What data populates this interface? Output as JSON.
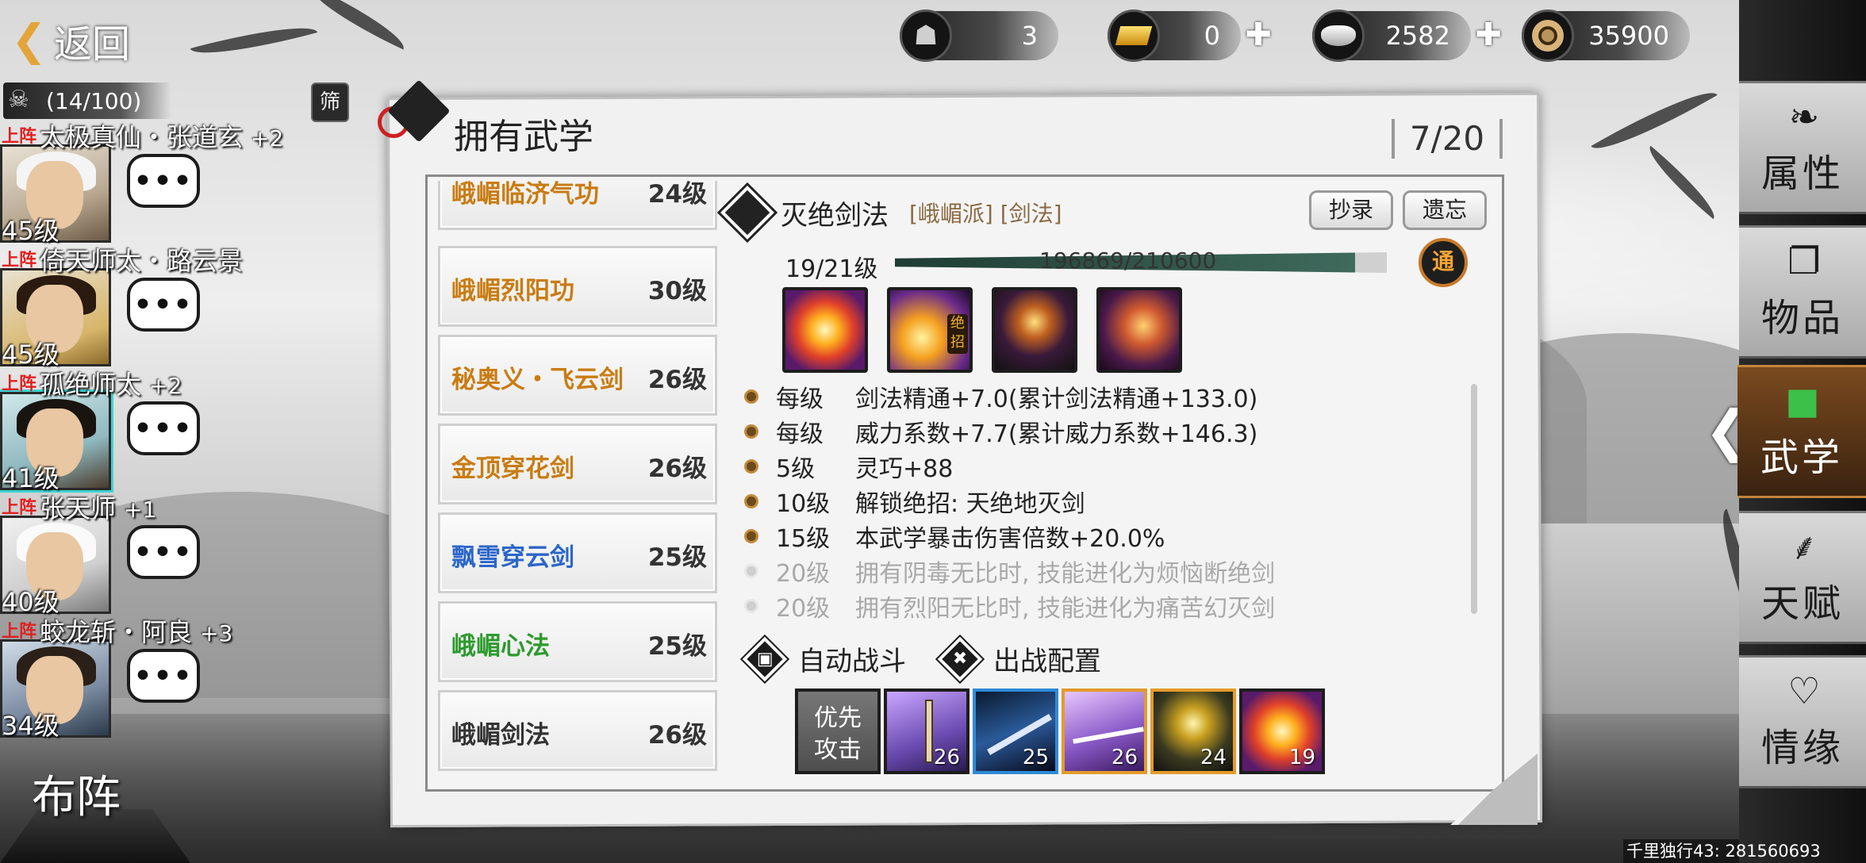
{
  "top": {
    "back_label": "返回",
    "currencies": [
      {
        "icon": "cauldron-icon",
        "value": "3"
      },
      {
        "icon": "gold-bar-icon",
        "value": "0"
      },
      {
        "icon": "silver-ingot-icon",
        "value": "2582"
      },
      {
        "icon": "copper-coin-icon",
        "value": "35900"
      }
    ]
  },
  "team": {
    "count": "(14/100)",
    "filter_label": "筛",
    "on_tag": "上阵",
    "heroes": [
      {
        "name": "太极真仙・张道玄",
        "bonus": "+2",
        "level": "45级",
        "chat": "•••"
      },
      {
        "name": "倚天师太・路云景",
        "bonus": "",
        "level": "45级",
        "chat": "•••"
      },
      {
        "name": "孤绝师太",
        "bonus": "+2",
        "level": "41级",
        "chat": "•••"
      },
      {
        "name": "张天师",
        "bonus": "+1",
        "level": "40级",
        "chat": "•••"
      },
      {
        "name": "蛟龙斩・阿良",
        "bonus": "+3",
        "level": "34级",
        "chat": "•••"
      }
    ],
    "formation_label": "布阵"
  },
  "panel": {
    "title": "拥有武学",
    "page_count": "7/20",
    "skills": [
      {
        "name": "峨嵋临济气功",
        "level": "24级",
        "color": "gold"
      },
      {
        "name": "峨嵋烈阳功",
        "level": "30级",
        "color": "gold"
      },
      {
        "name": "秘奥义・飞云剑",
        "level": "26级",
        "color": "gold"
      },
      {
        "name": "金顶穿花剑",
        "level": "26级",
        "color": "gold"
      },
      {
        "name": "飘雪穿云剑",
        "level": "25级",
        "color": "blue"
      },
      {
        "name": "峨嵋心法",
        "level": "25级",
        "color": "green"
      },
      {
        "name": "峨嵋剑法",
        "level": "26级",
        "color": "dark"
      }
    ],
    "detail": {
      "name": "灭绝剑法",
      "tags": "[峨嵋派] [剑法]",
      "copy_label": "抄录",
      "forget_label": "遗忘",
      "level_text": "19/21级",
      "xp_text": "196869/210600",
      "xp_fraction": 0.935,
      "tong_label": "通",
      "ult_badge": "绝招",
      "effects": [
        {
          "level": "每级",
          "text": "剑法精通+7.0(累计剑法精通+133.0)",
          "dim": false
        },
        {
          "level": "每级",
          "text": "威力系数+7.7(累计威力系数+146.3)",
          "dim": false
        },
        {
          "level": "5级",
          "text": "灵巧+88",
          "dim": false
        },
        {
          "level": "10级",
          "text": "解锁绝招:  天绝地灭剑",
          "dim": false
        },
        {
          "level": "15级",
          "text": "本武学暴击伤害倍数+20.0%",
          "dim": false
        },
        {
          "level": "20级",
          "text": "拥有阴毒无比时, 技能进化为烦恼断绝剑",
          "dim": true
        },
        {
          "level": "20级",
          "text": "拥有烈阳无比时, 技能进化为痛苦幻灭剑",
          "dim": true
        }
      ],
      "auto_battle_label": "自动战斗",
      "deploy_label": "出战配置",
      "priority_label_1": "优先",
      "priority_label_2": "攻击",
      "config_levels": [
        "26",
        "25",
        "26",
        "24",
        "19"
      ]
    }
  },
  "right_tabs": [
    {
      "label": "属性",
      "icon": "mouse-icon"
    },
    {
      "label": "物品",
      "icon": "gift-box-icon"
    },
    {
      "label": "武学",
      "icon": "book-icon"
    },
    {
      "label": "天赋",
      "icon": "branch-icon"
    },
    {
      "label": "情缘",
      "icon": "heart-icon"
    }
  ],
  "footer": {
    "text": "千里独行43: 281560693"
  }
}
